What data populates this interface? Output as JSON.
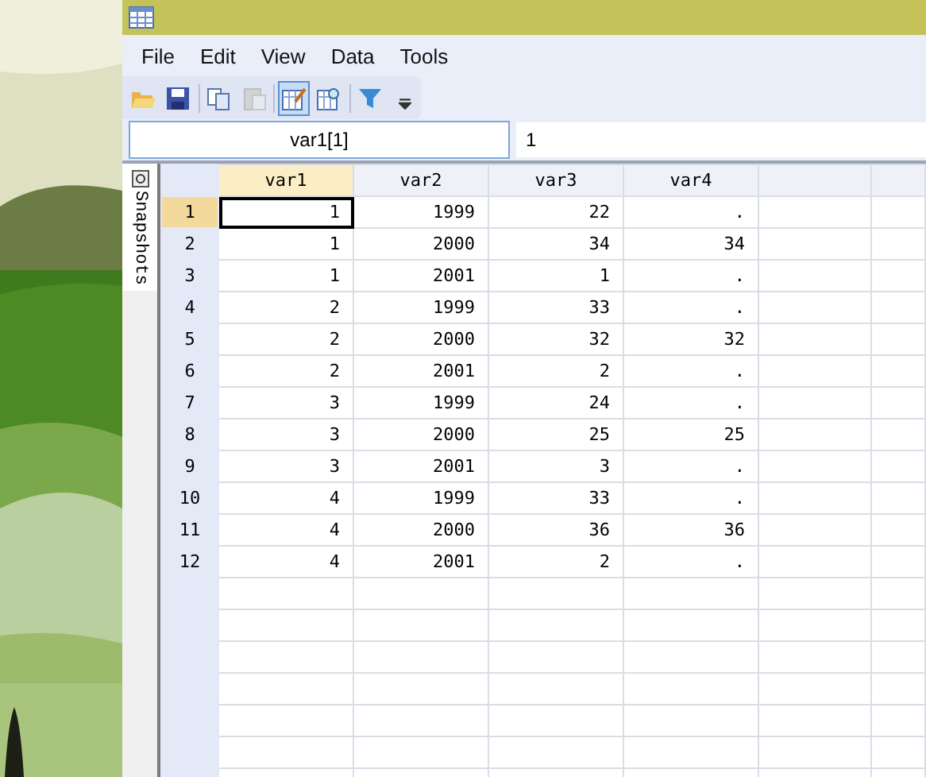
{
  "menu": [
    "File",
    "Edit",
    "View",
    "Data",
    "Tools"
  ],
  "toolbar": [
    {
      "kind": "open",
      "pressed": false,
      "disabled": false
    },
    {
      "kind": "save",
      "pressed": false,
      "disabled": false
    },
    {
      "kind": "separator"
    },
    {
      "kind": "copy",
      "pressed": false,
      "disabled": false
    },
    {
      "kind": "paste",
      "pressed": false,
      "disabled": true
    },
    {
      "kind": "separator"
    },
    {
      "kind": "edit",
      "pressed": true,
      "disabled": false
    },
    {
      "kind": "browse",
      "pressed": false,
      "disabled": false
    },
    {
      "kind": "separator"
    },
    {
      "kind": "filter",
      "pressed": false,
      "disabled": false
    },
    {
      "kind": "more",
      "pressed": false,
      "disabled": false
    }
  ],
  "cell_name": "var1[1]",
  "cell_value": "1",
  "side_tab": "Snapshots",
  "columns": [
    {
      "name": "var1",
      "selected": true
    },
    {
      "name": "var2",
      "selected": false
    },
    {
      "name": "var3",
      "selected": false
    },
    {
      "name": "var4",
      "selected": false
    }
  ],
  "rows": [
    {
      "num": "1",
      "selected": true,
      "cells": [
        "1",
        "1999",
        "22",
        "."
      ]
    },
    {
      "num": "2",
      "selected": false,
      "cells": [
        "1",
        "2000",
        "34",
        "34"
      ]
    },
    {
      "num": "3",
      "selected": false,
      "cells": [
        "1",
        "2001",
        "1",
        "."
      ]
    },
    {
      "num": "4",
      "selected": false,
      "cells": [
        "2",
        "1999",
        "33",
        "."
      ]
    },
    {
      "num": "5",
      "selected": false,
      "cells": [
        "2",
        "2000",
        "32",
        "32"
      ]
    },
    {
      "num": "6",
      "selected": false,
      "cells": [
        "2",
        "2001",
        "2",
        "."
      ]
    },
    {
      "num": "7",
      "selected": false,
      "cells": [
        "3",
        "1999",
        "24",
        "."
      ]
    },
    {
      "num": "8",
      "selected": false,
      "cells": [
        "3",
        "2000",
        "25",
        "25"
      ]
    },
    {
      "num": "9",
      "selected": false,
      "cells": [
        "3",
        "2001",
        "3",
        "."
      ]
    },
    {
      "num": "10",
      "selected": false,
      "cells": [
        "4",
        "1999",
        "33",
        "."
      ]
    },
    {
      "num": "11",
      "selected": false,
      "cells": [
        "4",
        "2000",
        "36",
        "36"
      ]
    },
    {
      "num": "12",
      "selected": false,
      "cells": [
        "4",
        "2001",
        "2",
        "."
      ]
    }
  ]
}
